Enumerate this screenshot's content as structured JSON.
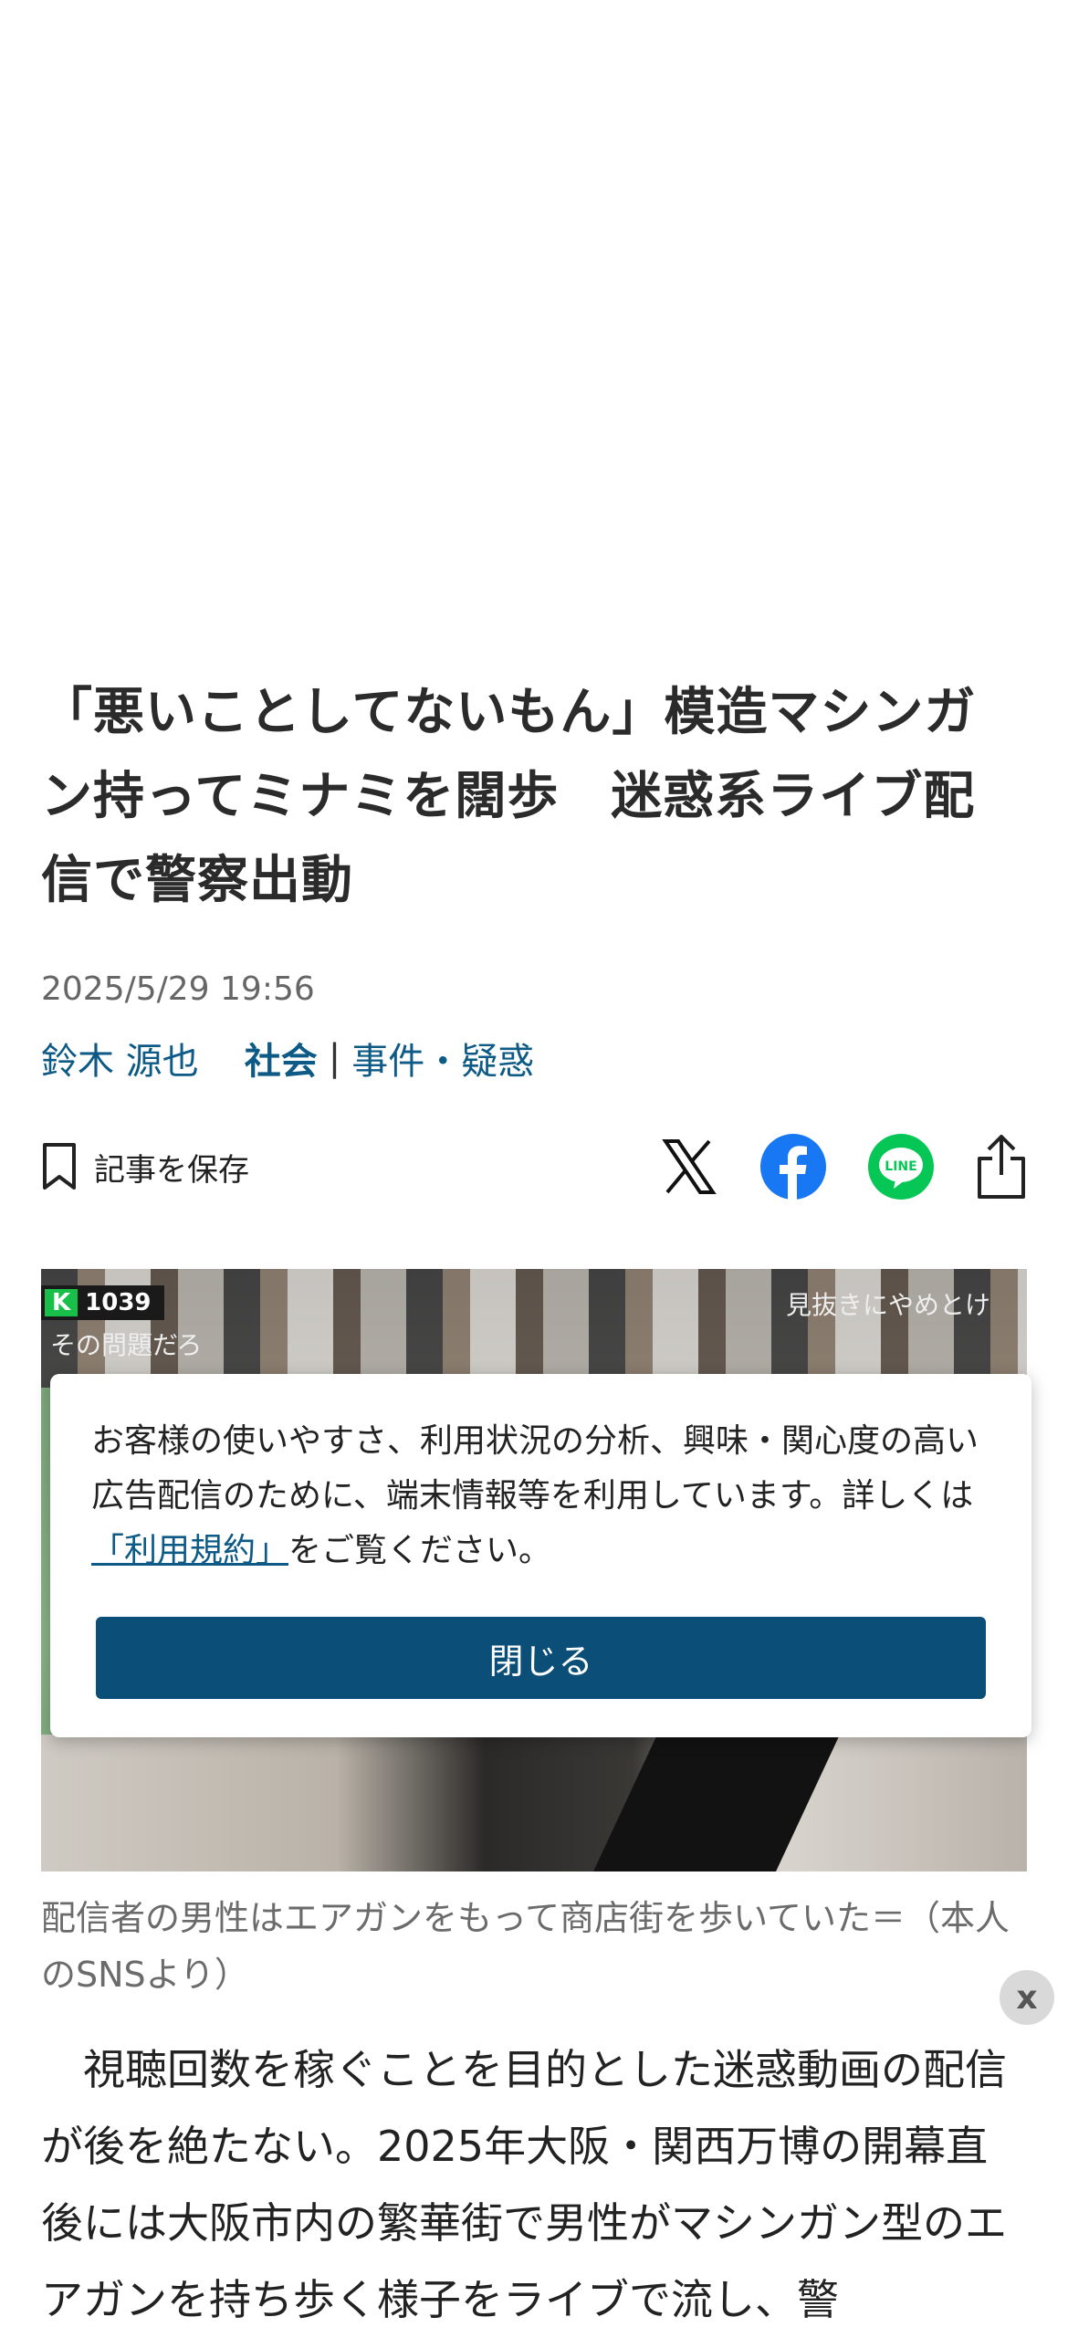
{
  "article": {
    "headline": "「悪いことしてないもん」模造マシンガン持ってミナミを闊歩　迷惑系ライブ配信で警察出動",
    "date": "2025/5/29 19:56",
    "author": "鈴木 源也",
    "category_main": "社会",
    "category_divider": "|",
    "category_sub": "事件・疑惑"
  },
  "actions": {
    "save_label": "記事を保存",
    "share": [
      {
        "name": "x-share",
        "icon": "x-logo-icon"
      },
      {
        "name": "facebook-share",
        "icon": "facebook-icon",
        "color": "#1877f2"
      },
      {
        "name": "line-share",
        "icon": "line-icon",
        "color": "#06c755",
        "label": "LINE"
      },
      {
        "name": "share",
        "icon": "share-icon"
      }
    ]
  },
  "photo": {
    "overlay_badge_letter": "K",
    "overlay_count": "1039",
    "overlay_text_left": "その問題だろ",
    "overlay_text_right": "見抜きにやめとけ",
    "caption": "配信者の男性はエアガンをもって商店街を歩いていた＝（本人のSNSより）"
  },
  "consent": {
    "text_before_link": "お客様の使いやすさ、利用状況の分析、興味・関心度の高い広告配信のために、端末情報等を利用しています。詳しくは",
    "link_text": "「利用規約」",
    "text_after_link": "をご覧ください。",
    "close_label": "閉じる"
  },
  "ad_close_label": "x",
  "body": {
    "paragraph": "　視聴回数を稼ぐことを目的とした迷惑動画の配信が後を絶たない。2025年大阪・関西万博の開幕直後には大阪市内の繁華街で男性がマシンガン型のエアガンを持ち歩く様子をライブで流し、警"
  },
  "colors": {
    "link_blue": "#0d5a86",
    "button_blue": "#0b4f78"
  }
}
